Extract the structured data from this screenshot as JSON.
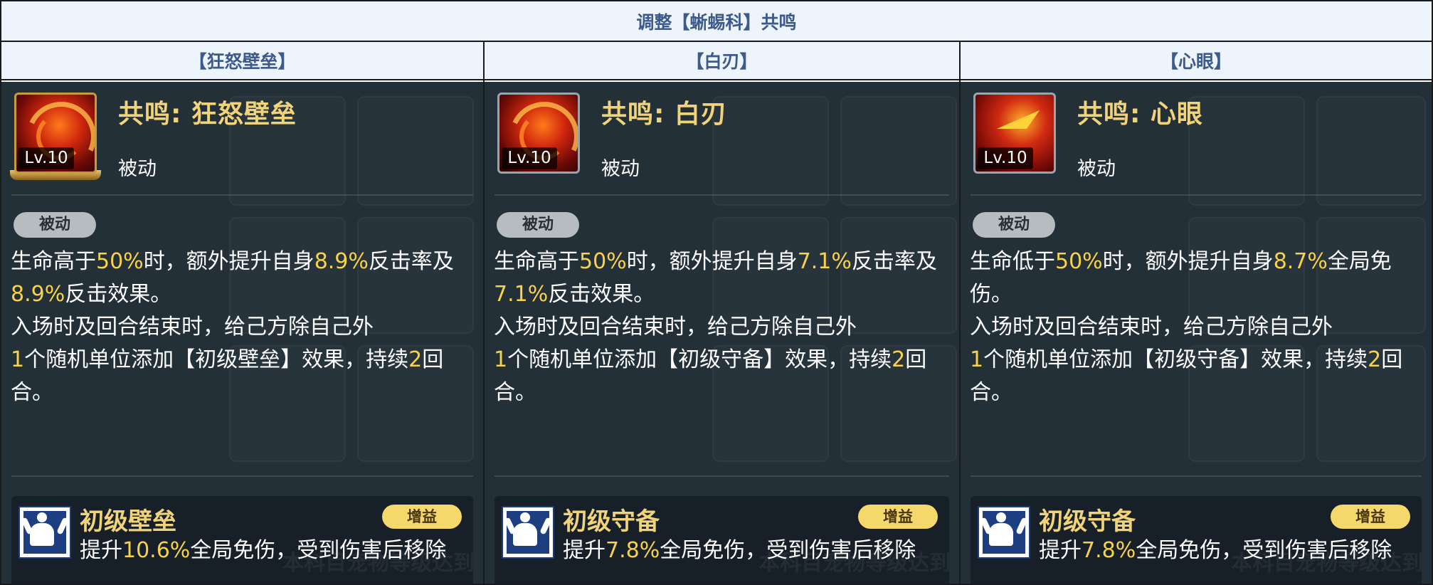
{
  "table_title": "调整【蜥蜴科】共鸣",
  "columns": [
    {
      "header": "【狂怒壁垒】",
      "skill_name": "共鸣: 狂怒壁垒",
      "level": "Lv.10",
      "skill_type": "被动",
      "pill": "被动",
      "desc": [
        [
          "生命高于",
          "50%",
          "时，额外提升自身",
          "8.9%",
          "反击率及",
          "8.9%",
          "反击效果。"
        ],
        [
          "入场时及回合结束时，给己方除自己外"
        ],
        [
          "",
          "1",
          "个随机单位添加【初级壁垒】效果，持续",
          "2",
          "回合。"
        ]
      ],
      "buff_name": "初级壁垒",
      "buff_tag": "增益",
      "buff_desc_pre": "提升",
      "buff_desc_val": "10.6%",
      "buff_desc_post": "全局免伤，受到伤害后移除",
      "watermark": "本科目宠物等级达到"
    },
    {
      "header": "【白刃】",
      "skill_name": "共鸣: 白刃",
      "level": "Lv.10",
      "skill_type": "被动",
      "pill": "被动",
      "desc": [
        [
          "生命高于",
          "50%",
          "时，额外提升自身",
          "7.1%",
          "反击率及",
          "7.1%",
          "反击效果。"
        ],
        [
          "入场时及回合结束时，给己方除自己外"
        ],
        [
          "",
          "1",
          "个随机单位添加【初级守备】效果，持续",
          "2",
          "回合。"
        ]
      ],
      "buff_name": "初级守备",
      "buff_tag": "增益",
      "buff_desc_pre": "提升",
      "buff_desc_val": "7.8%",
      "buff_desc_post": "全局免伤，受到伤害后移除",
      "watermark": "本科目宠物等级达到"
    },
    {
      "header": "【心眼】",
      "skill_name": "共鸣: 心眼",
      "level": "Lv.10",
      "skill_type": "被动",
      "pill": "被动",
      "desc": [
        [
          "生命低于",
          "50%",
          "时，额外提升自身",
          "8.7%",
          "全局免伤。"
        ],
        [
          "入场时及回合结束时，给己方除自己外"
        ],
        [
          "",
          "1",
          "个随机单位添加【初级守备】效果，持续",
          "2",
          "回合。"
        ]
      ],
      "buff_name": "初级守备",
      "buff_tag": "增益",
      "buff_desc_pre": "提升",
      "buff_desc_val": "7.8%",
      "buff_desc_post": "全局免伤，受到伤害后移除",
      "watermark": "本科目宠物等级达到"
    }
  ]
}
